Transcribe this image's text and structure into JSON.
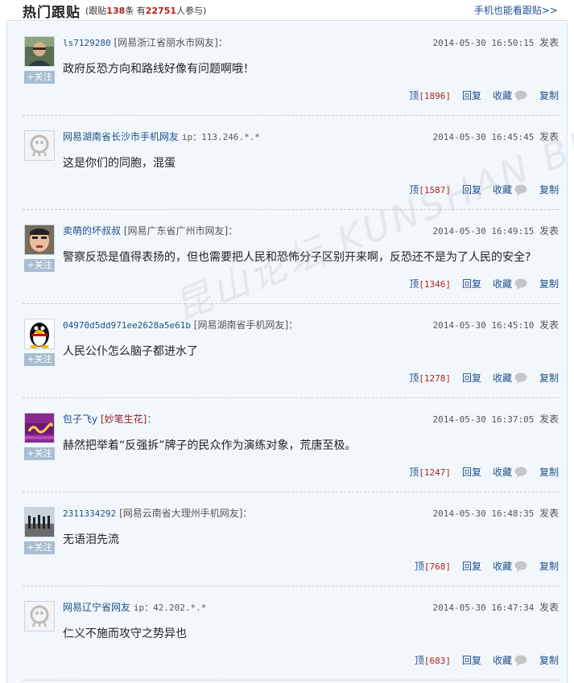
{
  "header": {
    "title": "热门跟贴",
    "stats_prefix": "(跟贴",
    "post_count": "138",
    "stats_mid": "条 有",
    "participants": "22751",
    "stats_suffix": "人参与)",
    "mobile_link": "手机也能看跟贴>>"
  },
  "actions": {
    "up_label": "顶",
    "reply_label": "回复",
    "fav_label": "收藏",
    "copy_label": "复制",
    "follow_label": "+关注",
    "post_suffix": "发表"
  },
  "watermark": "昆山论坛 KUNSHAN BBS",
  "posts": [
    {
      "user": "ls7129280",
      "source": "[网易浙江省丽水市网友]：",
      "time": "2014-05-30 16:50:15",
      "content": "政府反恐方向和路线好像有问题啊哦！",
      "votes": "[1896]",
      "avatar": "photo-man"
    },
    {
      "user": "网易湖南省长沙市手机网友",
      "source": "ip：113.246.*.*",
      "time": "2014-05-30 16:45:45",
      "content": "这是你们的同胞，混蛋",
      "votes": "[1587]",
      "avatar": "default"
    },
    {
      "user": "卖萌的坏叔叔",
      "source": "[网易广东省广州市网友]：",
      "time": "2014-05-30 16:49:15",
      "content": "警察反恐是值得表扬的，但也需要把人民和恐怖分子区别开来啊，反恐还不是为了人民的安全?",
      "votes": "[1346]",
      "avatar": "photo-face"
    },
    {
      "user": "04970d5dd971ee2628a5e61b",
      "source": "[网易湖南省手机网友]：",
      "time": "2014-05-30 16:45:10",
      "content": "人民公仆怎么脑子都进水了",
      "votes": "[1278]",
      "avatar": "penguin"
    },
    {
      "user": "包子飞y",
      "source": "[妙笔生花]",
      "source_end": "：",
      "time": "2014-05-30 16:37:05",
      "content": "赫然把举着“反强拆”牌子的民众作为演练对象，荒唐至极。",
      "votes": "[1247]",
      "avatar": "purple-logo"
    },
    {
      "user": "2311334292",
      "source": "[网易云南省大理州手机网友]：",
      "time": "2014-05-30 16:48:35",
      "content": "无语泪先流",
      "votes": "[768]",
      "avatar": "photo-crowd"
    },
    {
      "user": "网易辽宁省网友",
      "source": "ip：42.202.*.*",
      "time": "2014-05-30 16:47:34",
      "content": "仁义不施而攻守之势异也",
      "votes": "[683]",
      "avatar": "default"
    }
  ]
}
